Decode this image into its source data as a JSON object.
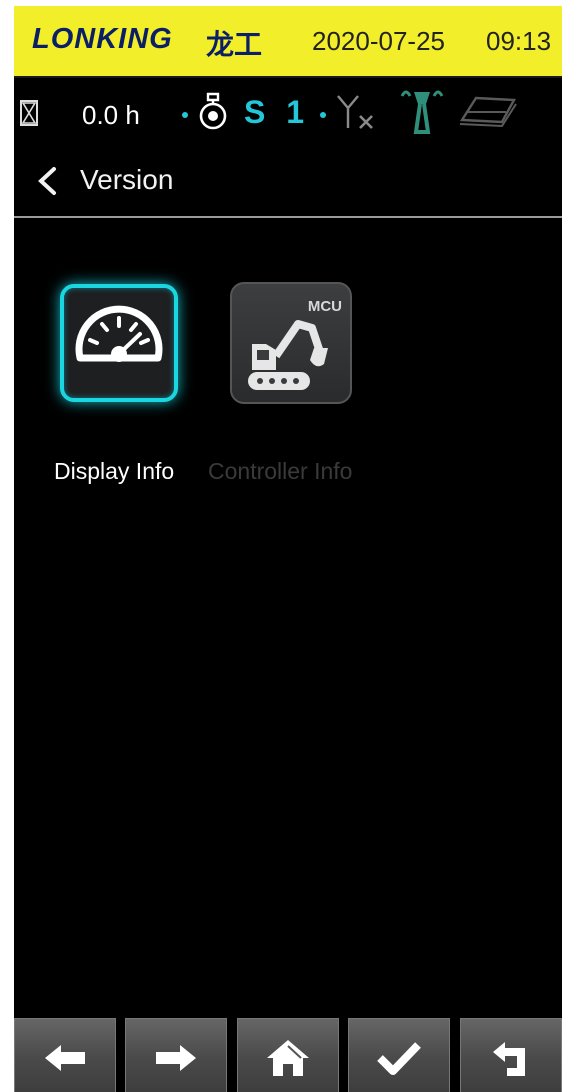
{
  "header": {
    "brand_logo": "LONKING",
    "brand_cn": "龙工",
    "date": "2020-07-25",
    "time": "09:13",
    "background": "#f2ef2a"
  },
  "status_bar": {
    "hours": "0.0 h",
    "speed_mode": "S 1",
    "accent_color": "#23c7d9",
    "icons": [
      "hourglass-icon",
      "engine-icon",
      "no-signal-icon",
      "signal-tower-icon",
      "book-icon"
    ]
  },
  "page": {
    "title": "Version"
  },
  "tiles": [
    {
      "label": "Display Info",
      "icon": "speedometer-icon",
      "selected": true
    },
    {
      "label": "Controller Info",
      "icon": "excavator-mcu-icon",
      "badge": "MCU",
      "enabled": false
    }
  ],
  "navbar": {
    "buttons": [
      "arrow-left-icon",
      "arrow-right-icon",
      "home-icon",
      "check-icon",
      "return-icon"
    ]
  }
}
